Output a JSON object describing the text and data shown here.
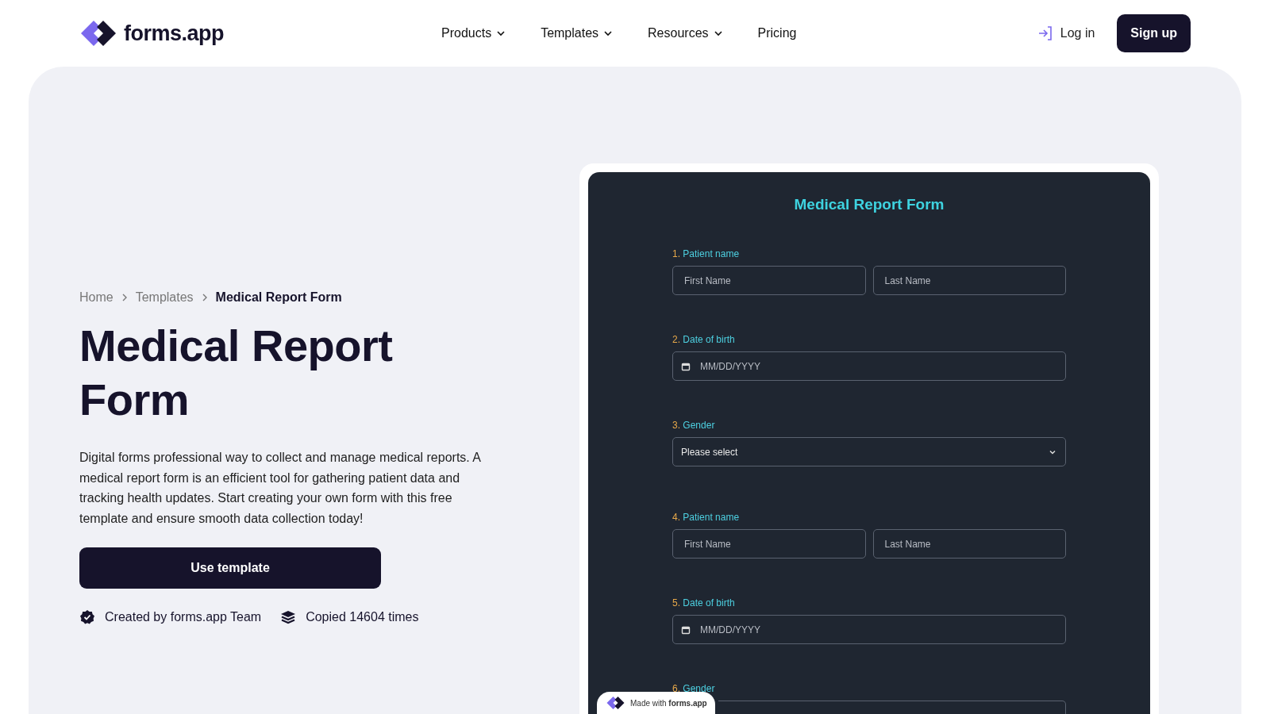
{
  "header": {
    "logo_text": "forms.app",
    "nav": [
      {
        "label": "Products",
        "has_menu": true
      },
      {
        "label": "Templates",
        "has_menu": true
      },
      {
        "label": "Resources",
        "has_menu": true
      },
      {
        "label": "Pricing",
        "has_menu": false
      }
    ],
    "login": "Log in",
    "signup": "Sign up"
  },
  "hero": {
    "breadcrumb": [
      {
        "label": "Home",
        "current": false
      },
      {
        "label": "Templates",
        "current": false
      },
      {
        "label": "Medical Report Form",
        "current": true
      }
    ],
    "title": "Medical Report Form",
    "description": "Digital forms professional way to collect and manage medical reports. A medical report form is an efficient tool for gathering patient data and tracking health updates. Start creating your own form with this free template and ensure smooth data collection today!",
    "button": "Use template",
    "meta": [
      {
        "kind": "verified",
        "text": "Created by forms.app Team"
      },
      {
        "kind": "copies",
        "text": "Copied 14604 times"
      }
    ]
  },
  "preview": {
    "title": "Medical Report Form",
    "questions": [
      {
        "number": "1.",
        "label": "Patient name",
        "kind": "name",
        "placeholders": [
          "First Name",
          "Last Name"
        ]
      },
      {
        "number": "2.",
        "label": "Date of birth",
        "kind": "date",
        "placeholders": [
          "MM/DD/YYYY"
        ]
      },
      {
        "number": "3.",
        "label": "Gender",
        "kind": "select",
        "placeholders": [
          "Please select"
        ]
      },
      {
        "number": "4.",
        "label": "Patient name",
        "kind": "name",
        "placeholders": [
          "First Name",
          "Last Name"
        ]
      },
      {
        "number": "5.",
        "label": "Date of birth",
        "kind": "date",
        "placeholders": [
          "MM/DD/YYYY"
        ]
      },
      {
        "number": "6.",
        "label": "Gender",
        "kind": "select"
      }
    ],
    "badge": {
      "prefix": "Made with ",
      "brand": "forms.app"
    }
  }
}
